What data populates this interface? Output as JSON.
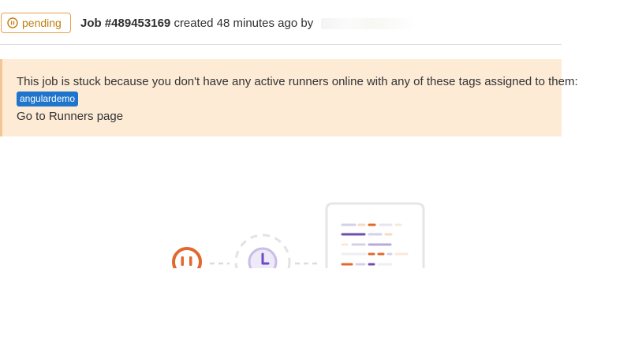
{
  "job_header": {
    "status_label": "pending",
    "job_id": "Job #489453169",
    "created_text": "created 48 minutes ago by"
  },
  "alert": {
    "message": "This job is stuck because you don't have any active runners online with any of these tags assigned to them:",
    "tag": "angulardemo",
    "runners_link": "Go to Runners page"
  },
  "icons": {
    "status": "pause-circle-icon",
    "illustration": "pending-job-illustration"
  },
  "colors": {
    "pending": "#c17d10",
    "alert_bg": "#fdebd6",
    "tag_bg": "#1f75cb"
  }
}
